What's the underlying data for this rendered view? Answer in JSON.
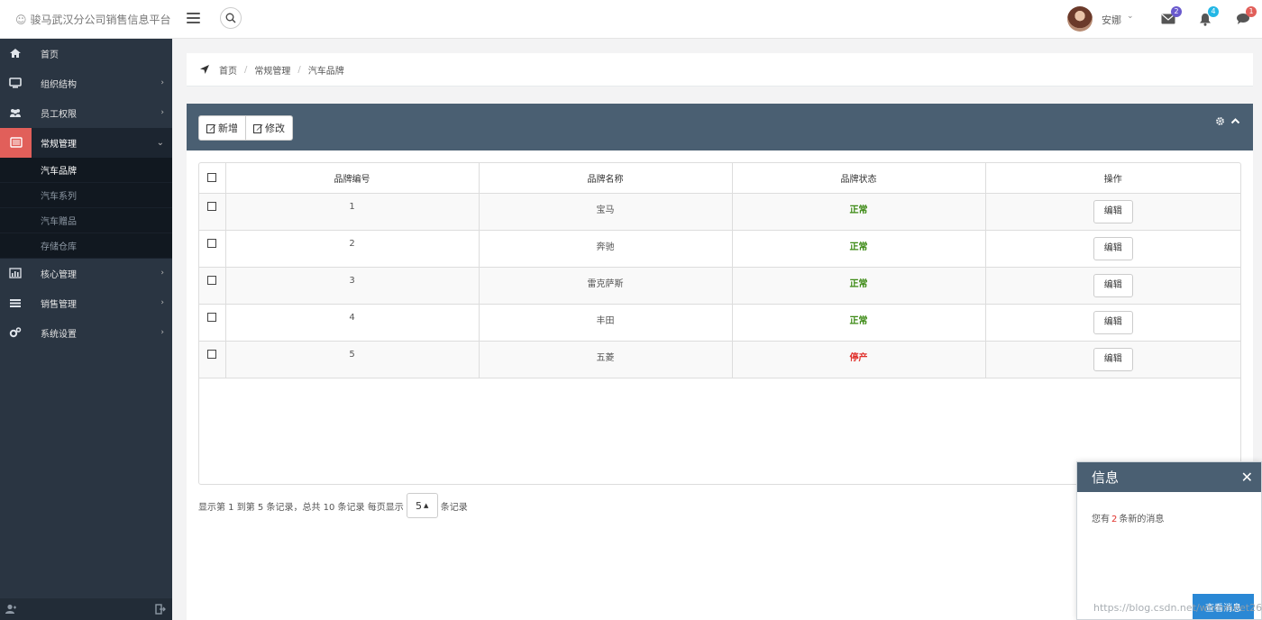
{
  "app": {
    "title": "骏马武汉分公司销售信息平台"
  },
  "header": {
    "username": "安娜",
    "badges": {
      "mail": "2",
      "bell": "4",
      "chat": "1"
    },
    "badge_colors": {
      "mail": "#6a5acd",
      "bell": "#23b7e5",
      "chat": "#e15f5a"
    }
  },
  "sidebar": {
    "items": [
      {
        "label": "首页",
        "icon": "home-icon"
      },
      {
        "label": "组织结构",
        "icon": "desktop-icon"
      },
      {
        "label": "员工权限",
        "icon": "users-icon"
      },
      {
        "label": "常规管理",
        "icon": "list-alt-icon"
      },
      {
        "label": "核心管理",
        "icon": "bar-chart-icon"
      },
      {
        "label": "销售管理",
        "icon": "list-icon"
      },
      {
        "label": "系统设置",
        "icon": "cogs-icon"
      }
    ],
    "subitems": [
      {
        "label": "汽车品牌"
      },
      {
        "label": "汽车系列"
      },
      {
        "label": "汽车赠品"
      },
      {
        "label": "存储仓库"
      }
    ],
    "active_color": "#e15f5a"
  },
  "breadcrumb": {
    "home": "首页",
    "section": "常规管理",
    "page": "汽车品牌"
  },
  "toolbar": {
    "add_label": "新增",
    "edit_label": "修改"
  },
  "table": {
    "columns": [
      "品牌编号",
      "品牌名称",
      "品牌状态",
      "操作"
    ],
    "edit_label": "编辑",
    "rows": [
      {
        "id": "1",
        "name": "宝马",
        "status": "正常",
        "status_type": "ok"
      },
      {
        "id": "2",
        "name": "奔驰",
        "status": "正常",
        "status_type": "ok"
      },
      {
        "id": "3",
        "name": "雷克萨斯",
        "status": "正常",
        "status_type": "ok"
      },
      {
        "id": "4",
        "name": "丰田",
        "status": "正常",
        "status_type": "ok"
      },
      {
        "id": "5",
        "name": "五菱",
        "status": "停产",
        "status_type": "stop"
      }
    ]
  },
  "pager": {
    "summary": "显示第 1 到第 5 条记录，总共 10 条记录 每页显示",
    "page_size": "5",
    "suffix": "条记录"
  },
  "popup": {
    "title": "信息",
    "text_before": "您有",
    "count": "2",
    "text_after": "条新的消息",
    "button": "查看消息"
  },
  "watermark": "https://blog.csdn.net/whmmnet26"
}
